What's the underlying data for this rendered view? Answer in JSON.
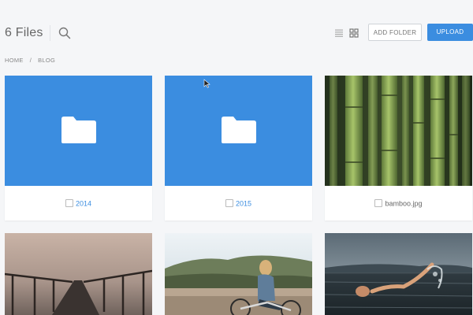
{
  "header": {
    "title": "6 Files",
    "add_folder_label": "ADD FOLDER",
    "upload_label": "UPLOAD"
  },
  "breadcrumb": {
    "items": [
      "HOME",
      "BLOG"
    ],
    "separator": "/"
  },
  "files": [
    {
      "name": "2014",
      "type": "folder"
    },
    {
      "name": "2015",
      "type": "folder"
    },
    {
      "name": "bamboo.jpg",
      "type": "image",
      "depicts": "bamboo stalks"
    },
    {
      "type": "image",
      "depicts": "pier in fog"
    },
    {
      "type": "image",
      "depicts": "woman on bicycle"
    },
    {
      "type": "image",
      "depicts": "swimmer in sea"
    }
  ],
  "colors": {
    "accent": "#3b8de0",
    "background": "#f5f6f8"
  }
}
